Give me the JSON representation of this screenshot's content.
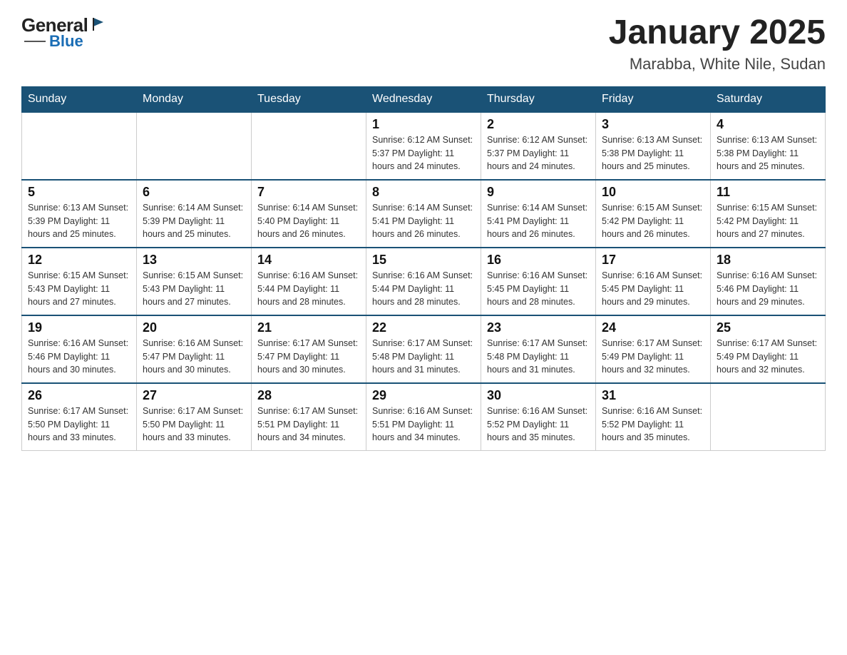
{
  "header": {
    "logo_general": "General",
    "logo_blue": "Blue",
    "title": "January 2025",
    "subtitle": "Marabba, White Nile, Sudan"
  },
  "weekdays": [
    "Sunday",
    "Monday",
    "Tuesday",
    "Wednesday",
    "Thursday",
    "Friday",
    "Saturday"
  ],
  "weeks": [
    [
      {
        "day": "",
        "info": ""
      },
      {
        "day": "",
        "info": ""
      },
      {
        "day": "",
        "info": ""
      },
      {
        "day": "1",
        "info": "Sunrise: 6:12 AM\nSunset: 5:37 PM\nDaylight: 11 hours\nand 24 minutes."
      },
      {
        "day": "2",
        "info": "Sunrise: 6:12 AM\nSunset: 5:37 PM\nDaylight: 11 hours\nand 24 minutes."
      },
      {
        "day": "3",
        "info": "Sunrise: 6:13 AM\nSunset: 5:38 PM\nDaylight: 11 hours\nand 25 minutes."
      },
      {
        "day": "4",
        "info": "Sunrise: 6:13 AM\nSunset: 5:38 PM\nDaylight: 11 hours\nand 25 minutes."
      }
    ],
    [
      {
        "day": "5",
        "info": "Sunrise: 6:13 AM\nSunset: 5:39 PM\nDaylight: 11 hours\nand 25 minutes."
      },
      {
        "day": "6",
        "info": "Sunrise: 6:14 AM\nSunset: 5:39 PM\nDaylight: 11 hours\nand 25 minutes."
      },
      {
        "day": "7",
        "info": "Sunrise: 6:14 AM\nSunset: 5:40 PM\nDaylight: 11 hours\nand 26 minutes."
      },
      {
        "day": "8",
        "info": "Sunrise: 6:14 AM\nSunset: 5:41 PM\nDaylight: 11 hours\nand 26 minutes."
      },
      {
        "day": "9",
        "info": "Sunrise: 6:14 AM\nSunset: 5:41 PM\nDaylight: 11 hours\nand 26 minutes."
      },
      {
        "day": "10",
        "info": "Sunrise: 6:15 AM\nSunset: 5:42 PM\nDaylight: 11 hours\nand 26 minutes."
      },
      {
        "day": "11",
        "info": "Sunrise: 6:15 AM\nSunset: 5:42 PM\nDaylight: 11 hours\nand 27 minutes."
      }
    ],
    [
      {
        "day": "12",
        "info": "Sunrise: 6:15 AM\nSunset: 5:43 PM\nDaylight: 11 hours\nand 27 minutes."
      },
      {
        "day": "13",
        "info": "Sunrise: 6:15 AM\nSunset: 5:43 PM\nDaylight: 11 hours\nand 27 minutes."
      },
      {
        "day": "14",
        "info": "Sunrise: 6:16 AM\nSunset: 5:44 PM\nDaylight: 11 hours\nand 28 minutes."
      },
      {
        "day": "15",
        "info": "Sunrise: 6:16 AM\nSunset: 5:44 PM\nDaylight: 11 hours\nand 28 minutes."
      },
      {
        "day": "16",
        "info": "Sunrise: 6:16 AM\nSunset: 5:45 PM\nDaylight: 11 hours\nand 28 minutes."
      },
      {
        "day": "17",
        "info": "Sunrise: 6:16 AM\nSunset: 5:45 PM\nDaylight: 11 hours\nand 29 minutes."
      },
      {
        "day": "18",
        "info": "Sunrise: 6:16 AM\nSunset: 5:46 PM\nDaylight: 11 hours\nand 29 minutes."
      }
    ],
    [
      {
        "day": "19",
        "info": "Sunrise: 6:16 AM\nSunset: 5:46 PM\nDaylight: 11 hours\nand 30 minutes."
      },
      {
        "day": "20",
        "info": "Sunrise: 6:16 AM\nSunset: 5:47 PM\nDaylight: 11 hours\nand 30 minutes."
      },
      {
        "day": "21",
        "info": "Sunrise: 6:17 AM\nSunset: 5:47 PM\nDaylight: 11 hours\nand 30 minutes."
      },
      {
        "day": "22",
        "info": "Sunrise: 6:17 AM\nSunset: 5:48 PM\nDaylight: 11 hours\nand 31 minutes."
      },
      {
        "day": "23",
        "info": "Sunrise: 6:17 AM\nSunset: 5:48 PM\nDaylight: 11 hours\nand 31 minutes."
      },
      {
        "day": "24",
        "info": "Sunrise: 6:17 AM\nSunset: 5:49 PM\nDaylight: 11 hours\nand 32 minutes."
      },
      {
        "day": "25",
        "info": "Sunrise: 6:17 AM\nSunset: 5:49 PM\nDaylight: 11 hours\nand 32 minutes."
      }
    ],
    [
      {
        "day": "26",
        "info": "Sunrise: 6:17 AM\nSunset: 5:50 PM\nDaylight: 11 hours\nand 33 minutes."
      },
      {
        "day": "27",
        "info": "Sunrise: 6:17 AM\nSunset: 5:50 PM\nDaylight: 11 hours\nand 33 minutes."
      },
      {
        "day": "28",
        "info": "Sunrise: 6:17 AM\nSunset: 5:51 PM\nDaylight: 11 hours\nand 34 minutes."
      },
      {
        "day": "29",
        "info": "Sunrise: 6:16 AM\nSunset: 5:51 PM\nDaylight: 11 hours\nand 34 minutes."
      },
      {
        "day": "30",
        "info": "Sunrise: 6:16 AM\nSunset: 5:52 PM\nDaylight: 11 hours\nand 35 minutes."
      },
      {
        "day": "31",
        "info": "Sunrise: 6:16 AM\nSunset: 5:52 PM\nDaylight: 11 hours\nand 35 minutes."
      },
      {
        "day": "",
        "info": ""
      }
    ]
  ]
}
